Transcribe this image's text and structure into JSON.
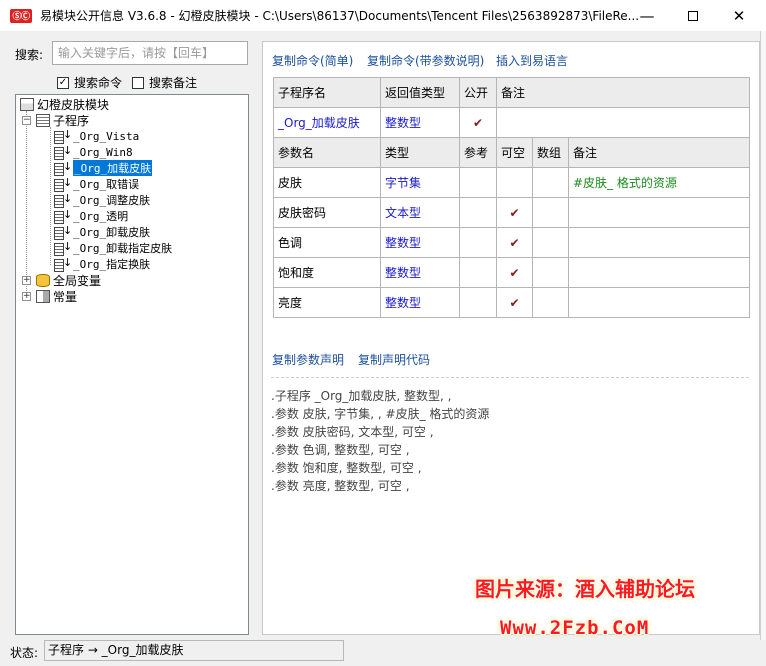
{
  "window": {
    "title": "易模块公开信息 V3.6.8 - 幻橙皮肤模块 - C:\\Users\\86137\\Documents\\Tencent Files\\2563892873\\FileRe...",
    "logo": "ⓈⒸ",
    "minimize": "—",
    "close": "✕"
  },
  "search": {
    "label": "搜索:",
    "placeholder": "输入关键字后，请按【回车】",
    "value": ""
  },
  "options": {
    "search_commands": {
      "label": "搜索命令",
      "checked": true,
      "mark": "✓"
    },
    "search_notes": {
      "label": "搜索备注",
      "checked": false,
      "mark": ""
    }
  },
  "tree": {
    "root": "幻橙皮肤模块",
    "subprograms": "子程序",
    "items": [
      "_Org_Vista",
      "_Org_Win8",
      "_Org_加载皮肤",
      "_Org_取错误",
      "_Org_调整皮肤",
      "_Org_透明",
      "_Org_卸载皮肤",
      "_Org_卸载指定皮肤",
      "_Org_指定换肤"
    ],
    "selected": "_Org_加载皮肤",
    "globals": "全局变量",
    "constants": "常量"
  },
  "links": {
    "copy_simple": "复制命令(简单)",
    "copy_with_params": "复制命令(带参数说明)",
    "insert": "插入到易语言",
    "copy_param_decl": "复制参数声明",
    "copy_decl_code": "复制声明代码"
  },
  "sub_table": {
    "headers": [
      "子程序名",
      "返回值类型",
      "公开",
      "备注"
    ],
    "row": {
      "name": "_Org_加载皮肤",
      "return_type": "整数型",
      "public": "✔",
      "note": ""
    }
  },
  "param_table": {
    "headers": [
      "参数名",
      "类型",
      "参考",
      "可空",
      "数组",
      "备注"
    ],
    "rows": [
      {
        "name": "皮肤",
        "type": "字节集",
        "ref": "",
        "nullable": "",
        "array": "",
        "note": "#皮肤_ 格式的资源"
      },
      {
        "name": "皮肤密码",
        "type": "文本型",
        "ref": "",
        "nullable": "✔",
        "array": "",
        "note": ""
      },
      {
        "name": "色调",
        "type": "整数型",
        "ref": "",
        "nullable": "✔",
        "array": "",
        "note": ""
      },
      {
        "name": "饱和度",
        "type": "整数型",
        "ref": "",
        "nullable": "✔",
        "array": "",
        "note": ""
      },
      {
        "name": "亮度",
        "type": "整数型",
        "ref": "",
        "nullable": "✔",
        "array": "",
        "note": ""
      }
    ]
  },
  "code_lines": [
    ".子程序 _Org_加载皮肤, 整数型, ,",
    ".参数 皮肤, 字节集, , #皮肤_ 格式的资源",
    ".参数 皮肤密码, 文本型, 可空 ,",
    ".参数 色调, 整数型, 可空 ,",
    ".参数 饱和度, 整数型, 可空 ,",
    ".参数 亮度, 整数型, 可空 ,"
  ],
  "watermark": {
    "line1": "图片来源：酒入辅助论坛",
    "line2": "Www.2Fzb.CoM"
  },
  "status": {
    "label": "状态:",
    "text": "子程序 → _Org_加载皮肤"
  }
}
